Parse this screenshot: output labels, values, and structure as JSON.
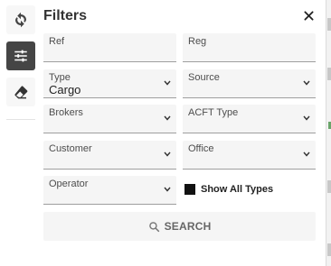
{
  "panel": {
    "title": "Filters"
  },
  "rail": {
    "items": [
      {
        "icon": "refresh-icon"
      },
      {
        "icon": "sliders-icon",
        "active": true
      },
      {
        "icon": "eraser-icon"
      }
    ]
  },
  "fields": {
    "ref": {
      "label": "Ref",
      "value": ""
    },
    "reg": {
      "label": "Reg",
      "value": ""
    },
    "type": {
      "label": "Type",
      "value": "Cargo"
    },
    "source": {
      "label": "Source",
      "value": ""
    },
    "brokers": {
      "label": "Brokers",
      "value": ""
    },
    "acft_type": {
      "label": "ACFT Type",
      "value": ""
    },
    "customer": {
      "label": "Customer",
      "value": ""
    },
    "office": {
      "label": "Office",
      "value": ""
    },
    "operator": {
      "label": "Operator",
      "value": ""
    }
  },
  "show_all_types": {
    "label": "Show All Types",
    "checked": true
  },
  "search": {
    "label": "SEARCH"
  },
  "colors": {
    "active_rail": "#454545",
    "field_bg": "#f5f5f5",
    "underline": "#9e9e9e"
  }
}
